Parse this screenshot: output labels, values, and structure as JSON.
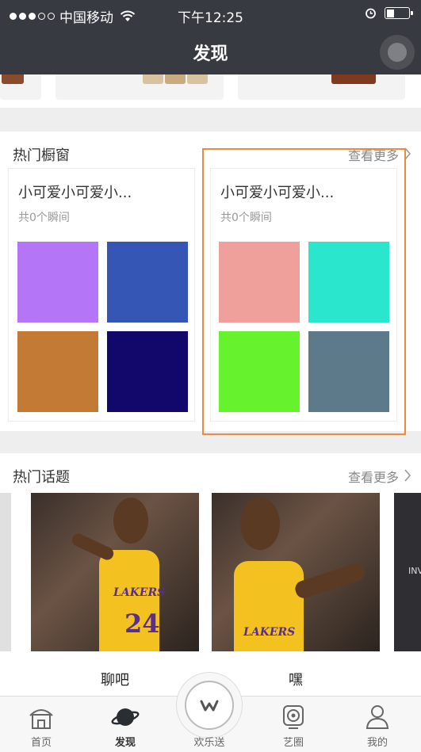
{
  "status_bar": {
    "carrier": "中国移动",
    "time": "下午12:25"
  },
  "nav": {
    "title": "发现"
  },
  "showcase": {
    "title": "热门橱窗",
    "more_label": "查看更多",
    "cards": [
      {
        "title": "小可爱小可爱小...",
        "subtitle": "共0个瞬间",
        "swatches": [
          "#b476f6",
          "#3556b5",
          "#c37a35",
          "#12086b"
        ]
      },
      {
        "title": "小可爱小可爱小...",
        "subtitle": "共0个瞬间",
        "swatches": [
          "#f0a09a",
          "#2ae6cd",
          "#66f22c",
          "#5d7a8b"
        ]
      }
    ]
  },
  "topics": {
    "title": "热门话题",
    "more_label": "查看更多",
    "items": [
      {
        "label": "聊吧",
        "jersey_text": "LAKERS",
        "jersey_number": "24"
      },
      {
        "label": "嘿",
        "jersey_text": "LAKERS"
      }
    ],
    "partial_text": "INV"
  },
  "tab_bar": {
    "home": "首页",
    "discover": "发现",
    "center": "欢乐送",
    "art": "艺圈",
    "me": "我的"
  },
  "colors": {
    "nav_bg": "#373a40",
    "highlight": "#ec8a3d"
  }
}
